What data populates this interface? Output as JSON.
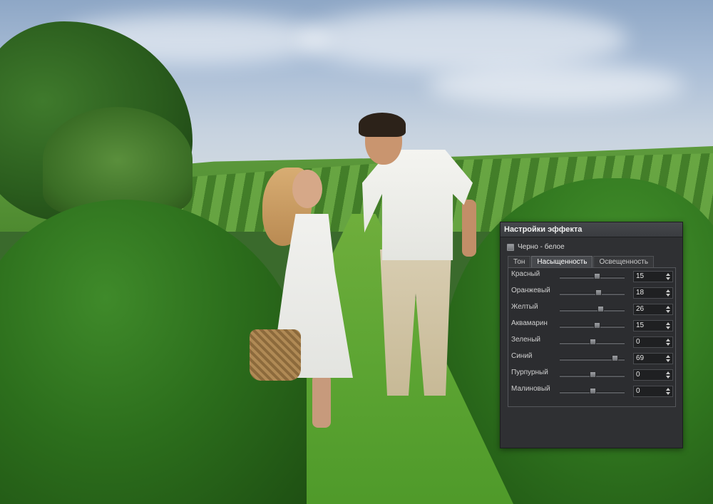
{
  "panel": {
    "title": "Настройки эффекта",
    "black_white_label": "Черно - белое",
    "black_white_checked": false
  },
  "tabs": [
    {
      "label": "Тон",
      "active": false
    },
    {
      "label": "Насыщенность",
      "active": true
    },
    {
      "label": "Освещенность",
      "active": false
    }
  ],
  "sliders": [
    {
      "label": "Красный",
      "value": "15",
      "fraction": 0.57
    },
    {
      "label": "Оранжевый",
      "value": "18",
      "fraction": 0.59
    },
    {
      "label": "Желтый",
      "value": "26",
      "fraction": 0.63
    },
    {
      "label": "Аквамарин",
      "value": "15",
      "fraction": 0.57
    },
    {
      "label": "Зеленый",
      "value": "0",
      "fraction": 0.5
    },
    {
      "label": "Синий",
      "value": "69",
      "fraction": 0.85
    },
    {
      "label": "Пурпурный",
      "value": "0",
      "fraction": 0.5
    },
    {
      "label": "Малиновый",
      "value": "0",
      "fraction": 0.5
    }
  ],
  "icons": {
    "spin_up": "arrow-up-icon",
    "spin_down": "arrow-down-icon"
  }
}
